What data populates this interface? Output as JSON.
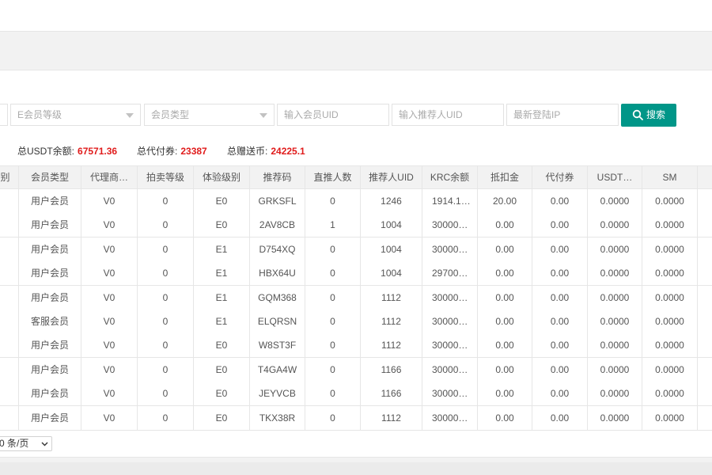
{
  "filters": {
    "e_level": "E会员等级",
    "member_type": "会员类型",
    "uid": "输入会员UID",
    "referrer_uid": "输入推荐人UID",
    "last_login_ip": "最新登陆IP",
    "search_label": "搜索"
  },
  "summary": {
    "usdt_label": "总USDT余额:",
    "usdt_value": "67571.36",
    "voucher_label": "总代付券:",
    "voucher_value": "23387",
    "gift_label": "总赠送币:",
    "gift_value": "24225.1"
  },
  "table": {
    "headers": [
      "别",
      "会员类型",
      "代理商…",
      "拍卖等级",
      "体验级别",
      "推荐码",
      "直推人数",
      "推荐人UID",
      "KRC余额",
      "抵扣金",
      "代付券",
      "USDT…",
      "SM"
    ],
    "rows": [
      [
        "",
        "用户会员",
        "V0",
        "0",
        "E0",
        "GRKSFL",
        "0",
        "1246",
        "1914.1…",
        "20.00",
        "0.00",
        "0.0000",
        "0.0000"
      ],
      [
        "",
        "用户会员",
        "V0",
        "0",
        "E0",
        "2AV8CB",
        "1",
        "1004",
        "30000…",
        "0.00",
        "0.00",
        "0.0000",
        "0.0000"
      ],
      [
        "",
        "用户会员",
        "V0",
        "0",
        "E1",
        "D754XQ",
        "0",
        "1004",
        "30000…",
        "0.00",
        "0.00",
        "0.0000",
        "0.0000"
      ],
      [
        "",
        "用户会员",
        "V0",
        "0",
        "E1",
        "HBX64U",
        "0",
        "1004",
        "29700…",
        "0.00",
        "0.00",
        "0.0000",
        "0.0000"
      ],
      [
        "",
        "用户会员",
        "V0",
        "0",
        "E1",
        "GQM368",
        "0",
        "1112",
        "30000…",
        "0.00",
        "0.00",
        "0.0000",
        "0.0000"
      ],
      [
        "",
        "客服会员",
        "V0",
        "0",
        "E1",
        "ELQRSN",
        "0",
        "1112",
        "30000…",
        "0.00",
        "0.00",
        "0.0000",
        "0.0000"
      ],
      [
        "",
        "用户会员",
        "V0",
        "0",
        "E0",
        "W8ST3F",
        "0",
        "1112",
        "30000…",
        "0.00",
        "0.00",
        "0.0000",
        "0.0000"
      ],
      [
        "",
        "用户会员",
        "V0",
        "0",
        "E0",
        "T4GA4W",
        "0",
        "1166",
        "30000…",
        "0.00",
        "0.00",
        "0.0000",
        "0.0000"
      ],
      [
        "",
        "用户会员",
        "V0",
        "0",
        "E0",
        "JEYVCB",
        "0",
        "1166",
        "30000…",
        "0.00",
        "0.00",
        "0.0000",
        "0.0000"
      ],
      [
        "",
        "用户会员",
        "V0",
        "0",
        "E0",
        "TKX38R",
        "0",
        "1112",
        "30000…",
        "0.00",
        "0.00",
        "0.0000",
        "0.0000"
      ]
    ]
  },
  "pager": {
    "page_size": "0 条/页"
  },
  "colors": {
    "accent": "#009688",
    "highlight": "#e01b1b"
  },
  "icons": {
    "search": "search-icon",
    "dropdown": "chevron-down-icon"
  }
}
